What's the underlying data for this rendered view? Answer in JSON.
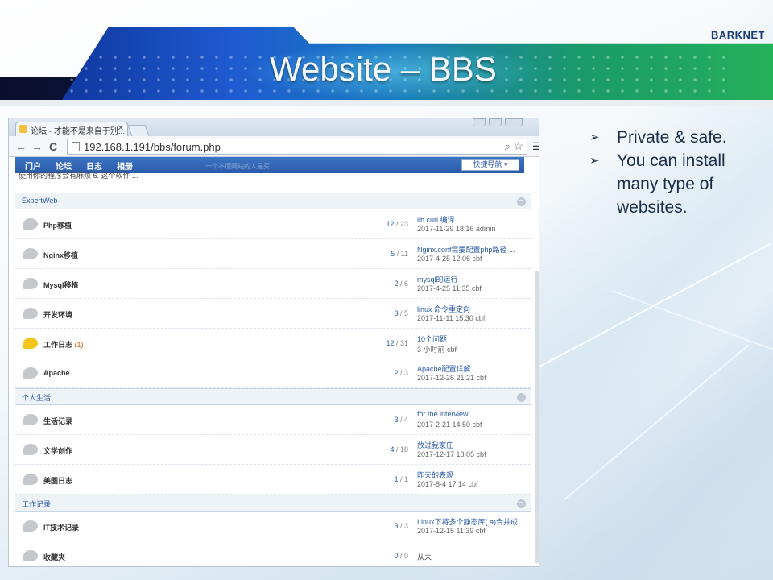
{
  "slide": {
    "brand": "BARKNET",
    "title": "Website – BBS",
    "bullets": [
      {
        "text": "Private & safe."
      },
      {
        "text": "You can install many type of websites."
      }
    ]
  },
  "browser": {
    "tab_title": "论坛 - 才能不是来自于别...",
    "url": "192.168.1.191/bbs/forum.php"
  },
  "site": {
    "nav": [
      "门户",
      "论坛",
      "日志",
      "相册"
    ],
    "quick_nav": "快捷导航 ▾",
    "overlay_text": "一个不懂网站的人是买",
    "snippet": "使用你的程序会有麻烦 6. 这个软件 ..."
  },
  "groups": [
    {
      "name": "ExpertWeb",
      "forums": [
        {
          "name": "Php移植",
          "new": "",
          "threads": "12",
          "posts": "23",
          "last_title": "lib curl 编译",
          "last_meta": "2017-11-29 18:16 admin",
          "hot": false
        },
        {
          "name": "Nginx移植",
          "new": "",
          "threads": "5",
          "posts": "11",
          "last_title": "Nginx.conf需要配置php路径 ...",
          "last_meta": "2017-4-25 12:06 cbf",
          "hot": false
        },
        {
          "name": "Mysql移植",
          "new": "",
          "threads": "2",
          "posts": "6",
          "last_title": "mysql的运行",
          "last_meta": "2017-4-25 11:35 cbf",
          "hot": false
        },
        {
          "name": "开发环境",
          "new": "",
          "threads": "3",
          "posts": "5",
          "last_title": "linux 命令重定向",
          "last_meta": "2017-11-11 15:30 cbf",
          "hot": false
        },
        {
          "name": "工作日志",
          "new": "(1)",
          "threads": "12",
          "posts": "31",
          "last_title": "10个问题",
          "last_meta": "3 小时前 cbf",
          "hot": true
        },
        {
          "name": "Apache",
          "new": "",
          "threads": "2",
          "posts": "3",
          "last_title": "Apache配置详解",
          "last_meta": "2017-12-26 21:21 cbf",
          "hot": false
        }
      ]
    },
    {
      "name": "个人生活",
      "forums": [
        {
          "name": "生活记录",
          "new": "",
          "threads": "3",
          "posts": "4",
          "last_title": "for the interview",
          "last_meta": "2017-2-21 14:50 cbf",
          "hot": false
        },
        {
          "name": "文学创作",
          "new": "",
          "threads": "4",
          "posts": "18",
          "last_title": "放过我家庄",
          "last_meta": "2017-12-17 18:05 cbf",
          "hot": false
        },
        {
          "name": "美图日志",
          "new": "",
          "threads": "1",
          "posts": "1",
          "last_title": "昨天的表现",
          "last_meta": "2017-8-4 17:14 cbf",
          "hot": false
        }
      ]
    },
    {
      "name": "工作记录",
      "forums": [
        {
          "name": "IT技术记录",
          "new": "",
          "threads": "3",
          "posts": "3",
          "last_title": "Linux下将多个静态库(.a)合并成 ...",
          "last_meta": "2017-12-15 11:39 cbf",
          "hot": false
        },
        {
          "name": "收藏夹",
          "new": "",
          "threads": "0",
          "posts": "0",
          "last_title": "",
          "last_meta": "从未",
          "hot": false
        }
      ]
    }
  ]
}
